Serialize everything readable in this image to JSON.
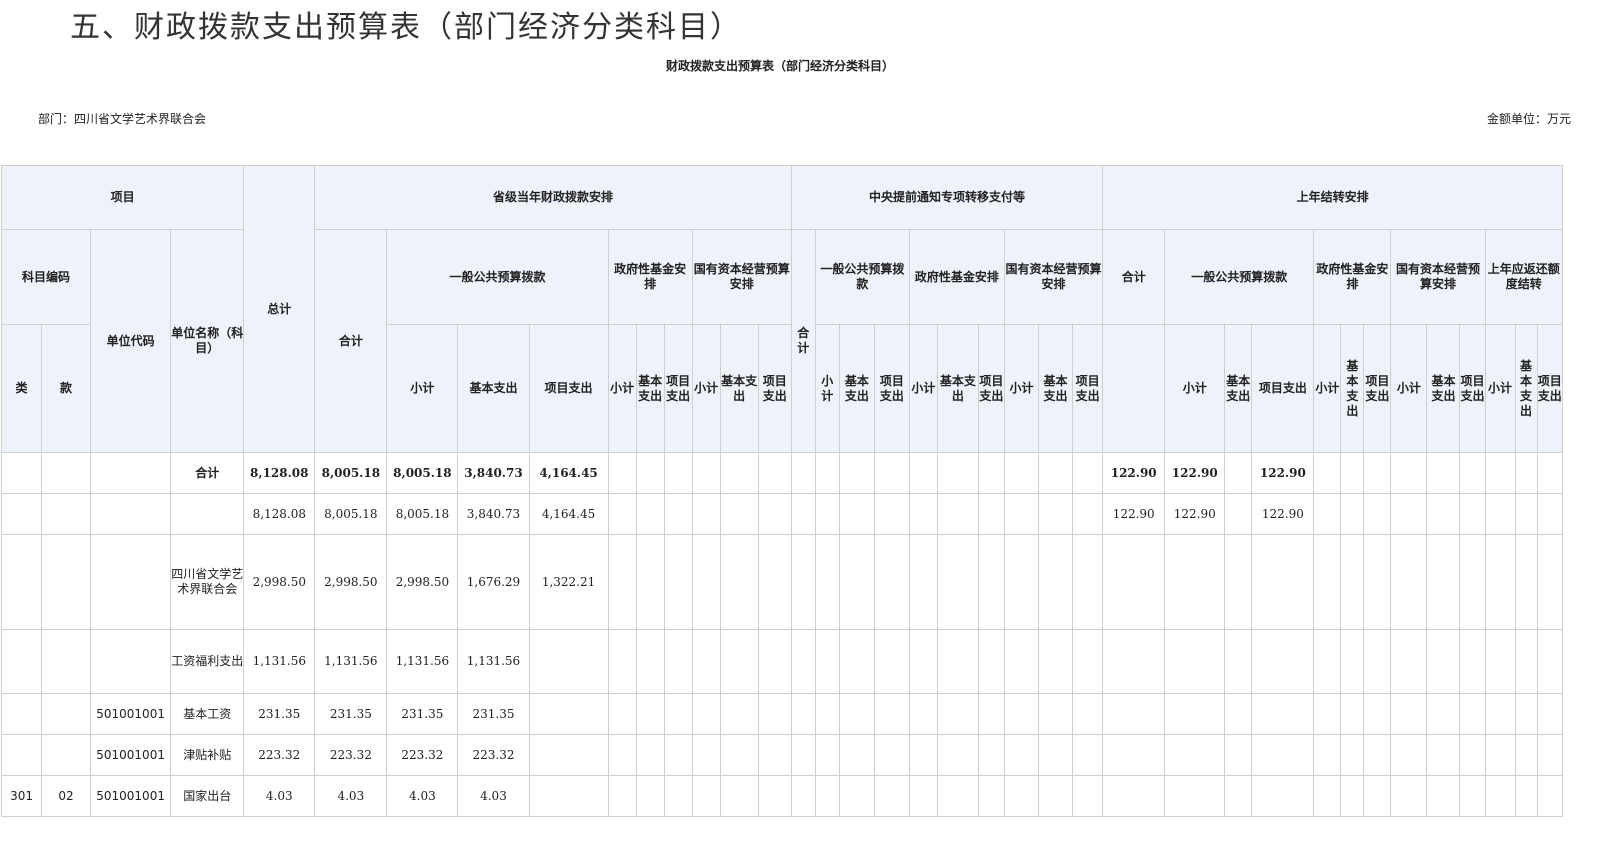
{
  "page": {
    "title": "五、财政拨款支出预算表（部门经济分类科目）",
    "subtitle": "财政拨款支出预算表（部门经济分类科目）",
    "department": "部门：四川省文学艺术界联合会",
    "unit": "金额单位：万元"
  },
  "headers": {
    "project": "项目",
    "code": "科目编码",
    "class": "类",
    "kuan": "款",
    "unit_code": "单位代码",
    "unit_name": "单位名称（科目）",
    "total": "总计",
    "provincial": "省级当年财政拨款安排",
    "central": "中央提前通知专项转移支付等",
    "carryover": "上年结转安排",
    "heji": "合计",
    "general_budget": "一般公共预算拨款",
    "gov_fund": "政府性基金安排",
    "state_capital": "国有资本经营预算安排",
    "c_general": "一般公共预算拨款",
    "c_gov_fund": "政府性基金安排",
    "c_state_capital": "国有资本经营预算安排",
    "y_general": "一般公共预算拨款",
    "y_gov_fund": "政府性基金安排",
    "y_state_capital": "国有资本经营预算安排",
    "y_refund": "上年应返还额度结转",
    "subtotal": "小计",
    "basic": "基本支出",
    "project_exp": "项目支出"
  },
  "rows": [
    {
      "lei": "",
      "kuan": "",
      "code": "",
      "name": "合计",
      "total": "8,128.08",
      "p_total": "8,005.18",
      "p_sub": "8,005.18",
      "p_basic": "3,840.73",
      "p_proj": "4,164.45",
      "y_total": "122.90",
      "y_sub": "122.90",
      "y_proj": "122.90"
    },
    {
      "lei": "",
      "kuan": "",
      "code": "",
      "name": "",
      "total": "8,128.08",
      "p_total": "8,005.18",
      "p_sub": "8,005.18",
      "p_basic": "3,840.73",
      "p_proj": "4,164.45",
      "y_total": "122.90",
      "y_sub": "122.90",
      "y_proj": "122.90"
    },
    {
      "lei": "",
      "kuan": "",
      "code": "",
      "name": "四川省文学艺术界联合会",
      "total": "2,998.50",
      "p_total": "2,998.50",
      "p_sub": "2,998.50",
      "p_basic": "1,676.29",
      "p_proj": "1,322.21",
      "y_total": "",
      "y_sub": "",
      "y_proj": ""
    },
    {
      "lei": "",
      "kuan": "",
      "code": "",
      "name": "工资福利支出",
      "total": "1,131.56",
      "p_total": "1,131.56",
      "p_sub": "1,131.56",
      "p_basic": "1,131.56",
      "p_proj": "",
      "y_total": "",
      "y_sub": "",
      "y_proj": ""
    },
    {
      "lei": "",
      "kuan": "",
      "code": "501001001",
      "name": "基本工资",
      "total": "231.35",
      "p_total": "231.35",
      "p_sub": "231.35",
      "p_basic": "231.35",
      "p_proj": "",
      "y_total": "",
      "y_sub": "",
      "y_proj": ""
    },
    {
      "lei": "",
      "kuan": "",
      "code": "501001001",
      "name": "津贴补贴",
      "total": "223.32",
      "p_total": "223.32",
      "p_sub": "223.32",
      "p_basic": "223.32",
      "p_proj": "",
      "y_total": "",
      "y_sub": "",
      "y_proj": ""
    },
    {
      "lei": "301",
      "kuan": "02",
      "code": "501001001",
      "name": "国家出台",
      "total": "4.03",
      "p_total": "4.03",
      "p_sub": "4.03",
      "p_basic": "4.03",
      "p_proj": "",
      "y_total": "",
      "y_sub": "",
      "y_proj": ""
    }
  ]
}
